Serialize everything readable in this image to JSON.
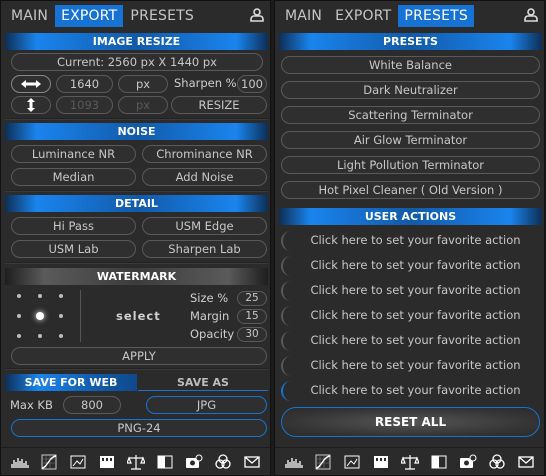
{
  "tabs": {
    "main": "MAIN",
    "export": "EXPORT",
    "presets": "PRESETS"
  },
  "left": {
    "image_resize": {
      "title": "IMAGE RESIZE",
      "current": "Current: 2560 px X 1440 px",
      "width_value": "1640",
      "height_value": "1093",
      "unit": "px",
      "sharpen_label": "Sharpen %",
      "sharpen_value": "100",
      "resize_label": "RESIZE"
    },
    "noise": {
      "title": "NOISE",
      "buttons": [
        "Luminance NR",
        "Chrominance NR",
        "Median",
        "Add Noise"
      ]
    },
    "detail": {
      "title": "DETAIL",
      "buttons": [
        "Hi Pass",
        "USM Edge",
        "USM Lab",
        "Sharpen Lab"
      ]
    },
    "watermark": {
      "title": "WATERMARK",
      "select_label": "select",
      "size_label": "Size %",
      "size_value": "25",
      "margin_label": "Margin",
      "margin_value": "15",
      "opacity_label": "Opacity",
      "opacity_value": "30",
      "apply_label": "APPLY"
    },
    "save": {
      "save_web": "SAVE FOR WEB",
      "save_as": "SAVE AS",
      "max_kb_label": "Max KB",
      "max_kb_value": "800",
      "jpg": "JPG",
      "png": "PNG-24"
    }
  },
  "right": {
    "presets_title": "PRESETS",
    "presets": [
      "White Balance",
      "Dark Neutralizer",
      "Scattering Terminator",
      "Air Glow Terminator",
      "Light Pollution Terminator",
      "Hot Pixel Cleaner ( Old Version )"
    ],
    "user_actions_title": "USER ACTIONS",
    "user_actions": [
      "Click here to set your favorite action",
      "Click here to set your favorite action",
      "Click here to set your favorite action",
      "Click here to set your favorite action",
      "Click here to set your favorite action",
      "Click here to set your favorite action",
      "Click here to set your favorite action"
    ],
    "reset_label": "RESET ALL"
  },
  "footer_icons": [
    "histogram-icon",
    "curves-icon",
    "levels-icon",
    "film-icon",
    "balance-icon",
    "contrast-icon",
    "camera-refresh-icon",
    "color-wheel-icon",
    "mail-icon"
  ],
  "colors": {
    "accent": "#1673d4",
    "panel": "#2b2b2b"
  }
}
